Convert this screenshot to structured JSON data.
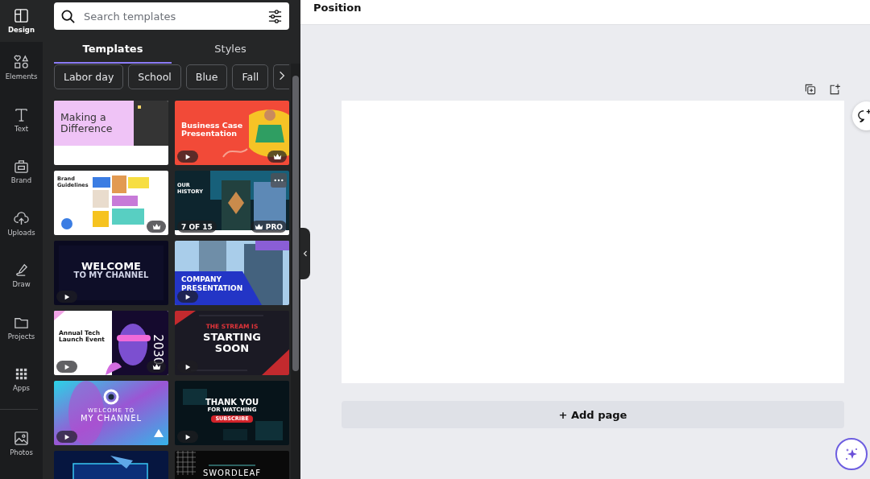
{
  "sidebar": {
    "items": [
      {
        "label": "Design",
        "selected": true
      },
      {
        "label": "Elements",
        "selected": false
      },
      {
        "label": "Text",
        "selected": false
      },
      {
        "label": "Brand",
        "selected": false
      },
      {
        "label": "Uploads",
        "selected": false
      },
      {
        "label": "Draw",
        "selected": false
      },
      {
        "label": "Projects",
        "selected": false
      },
      {
        "label": "Apps",
        "selected": false
      }
    ],
    "bottom_items": [
      {
        "label": "Photos",
        "selected": false
      }
    ]
  },
  "panel": {
    "search": {
      "placeholder": "Search templates"
    },
    "tabs": [
      {
        "label": "Templates",
        "selected": true
      },
      {
        "label": "Styles",
        "selected": false
      }
    ],
    "chips": [
      "Labor day",
      "School",
      "Blue",
      "Fall"
    ],
    "templates": [
      {
        "kind": "pink",
        "lines": [
          "Making a",
          "Difference"
        ],
        "play": false,
        "premium": false,
        "more": false
      },
      {
        "kind": "red",
        "lines": [
          "Business Case",
          "Presentation"
        ],
        "play": true,
        "premium": true,
        "more": false
      },
      {
        "kind": "collage",
        "lines": [
          "Brand",
          "Guidelines"
        ],
        "play": false,
        "premium": true,
        "more": false
      },
      {
        "kind": "teal",
        "lines": [
          "OUR",
          "HISTORY"
        ],
        "play": false,
        "premium": true,
        "more": true,
        "page_count": "7 OF 15",
        "pro_label": "PRO"
      },
      {
        "kind": "navy",
        "lines": [
          "WELCOME",
          "TO MY CHANNEL"
        ],
        "play": true,
        "premium": false,
        "more": false
      },
      {
        "kind": "blue",
        "lines": [
          "COMPANY",
          "PRESENTATION"
        ],
        "play": true,
        "premium": false,
        "more": false
      },
      {
        "kind": "tech",
        "lines": [
          "Annual Tech",
          "Launch Event",
          "2030"
        ],
        "play": true,
        "premium": true,
        "more": false
      },
      {
        "kind": "stream",
        "lines": [
          "THE STREAM IS",
          "STARTING",
          "SOON"
        ],
        "play": true,
        "premium": false,
        "more": false
      },
      {
        "kind": "gradient",
        "lines": [
          "WELCOME TO",
          "MY CHANNEL"
        ],
        "play": true,
        "premium": false,
        "more": false
      },
      {
        "kind": "thanks",
        "lines": [
          "THANK YOU",
          "FOR WATCHING",
          "SUBSCRIBE"
        ],
        "play": true,
        "premium": false,
        "more": false
      },
      {
        "kind": "glow"
      },
      {
        "kind": "sword",
        "lines": [
          "SWORDLEAF"
        ]
      }
    ]
  },
  "editor": {
    "title": "Position",
    "add_page": "+ Add page"
  }
}
